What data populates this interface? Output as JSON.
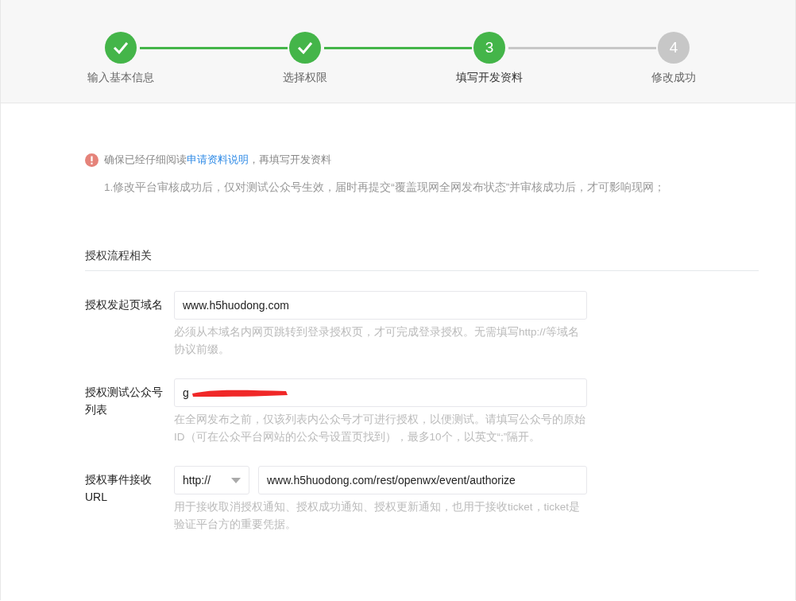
{
  "steps": [
    {
      "label": "输入基本信息",
      "completed": true,
      "selected": false
    },
    {
      "label": "选择权限",
      "completed": true,
      "selected": false
    },
    {
      "number": "3",
      "label": "填写开发资料",
      "completed": false,
      "selected": true
    },
    {
      "number": "4",
      "label": "修改成功",
      "completed": false,
      "selected": false
    }
  ],
  "notice": {
    "before": "确保已经仔细阅读",
    "link": "申请资料说明",
    "after": "，再填写开发资料"
  },
  "note": "1.修改平台审核成功后，仅对测试公众号生效，届时再提交“覆盖现网全网发布状态”并审核成功后，才可影响现网；",
  "section_title": "授权流程相关",
  "fields": [
    {
      "kind": "text",
      "label": "授权发起页域名",
      "value": "www.h5huodong.com",
      "redacted": false,
      "hint": "必须从本域名内网页跳转到登录授权页，才可完成登录授权。无需填写http://等域名协议前缀。"
    },
    {
      "kind": "text",
      "label": "授权测试公众号列表",
      "value": "g",
      "redacted": true,
      "hint": "在全网发布之前，仅该列表内公众号才可进行授权，以便测试。请填写公众号的原始ID（可在公众平台网站的公众号设置页找到），最多10个，以英文“;”隔开。"
    },
    {
      "kind": "url",
      "label": "授权事件接收URL",
      "protocol": "http://",
      "value": "www.h5huodong.com/rest/openwx/event/authorize",
      "hint": "用于接收取消授权通知、授权成功通知、授权更新通知，也用于接收ticket，ticket是验证平台方的重要凭据。"
    }
  ]
}
